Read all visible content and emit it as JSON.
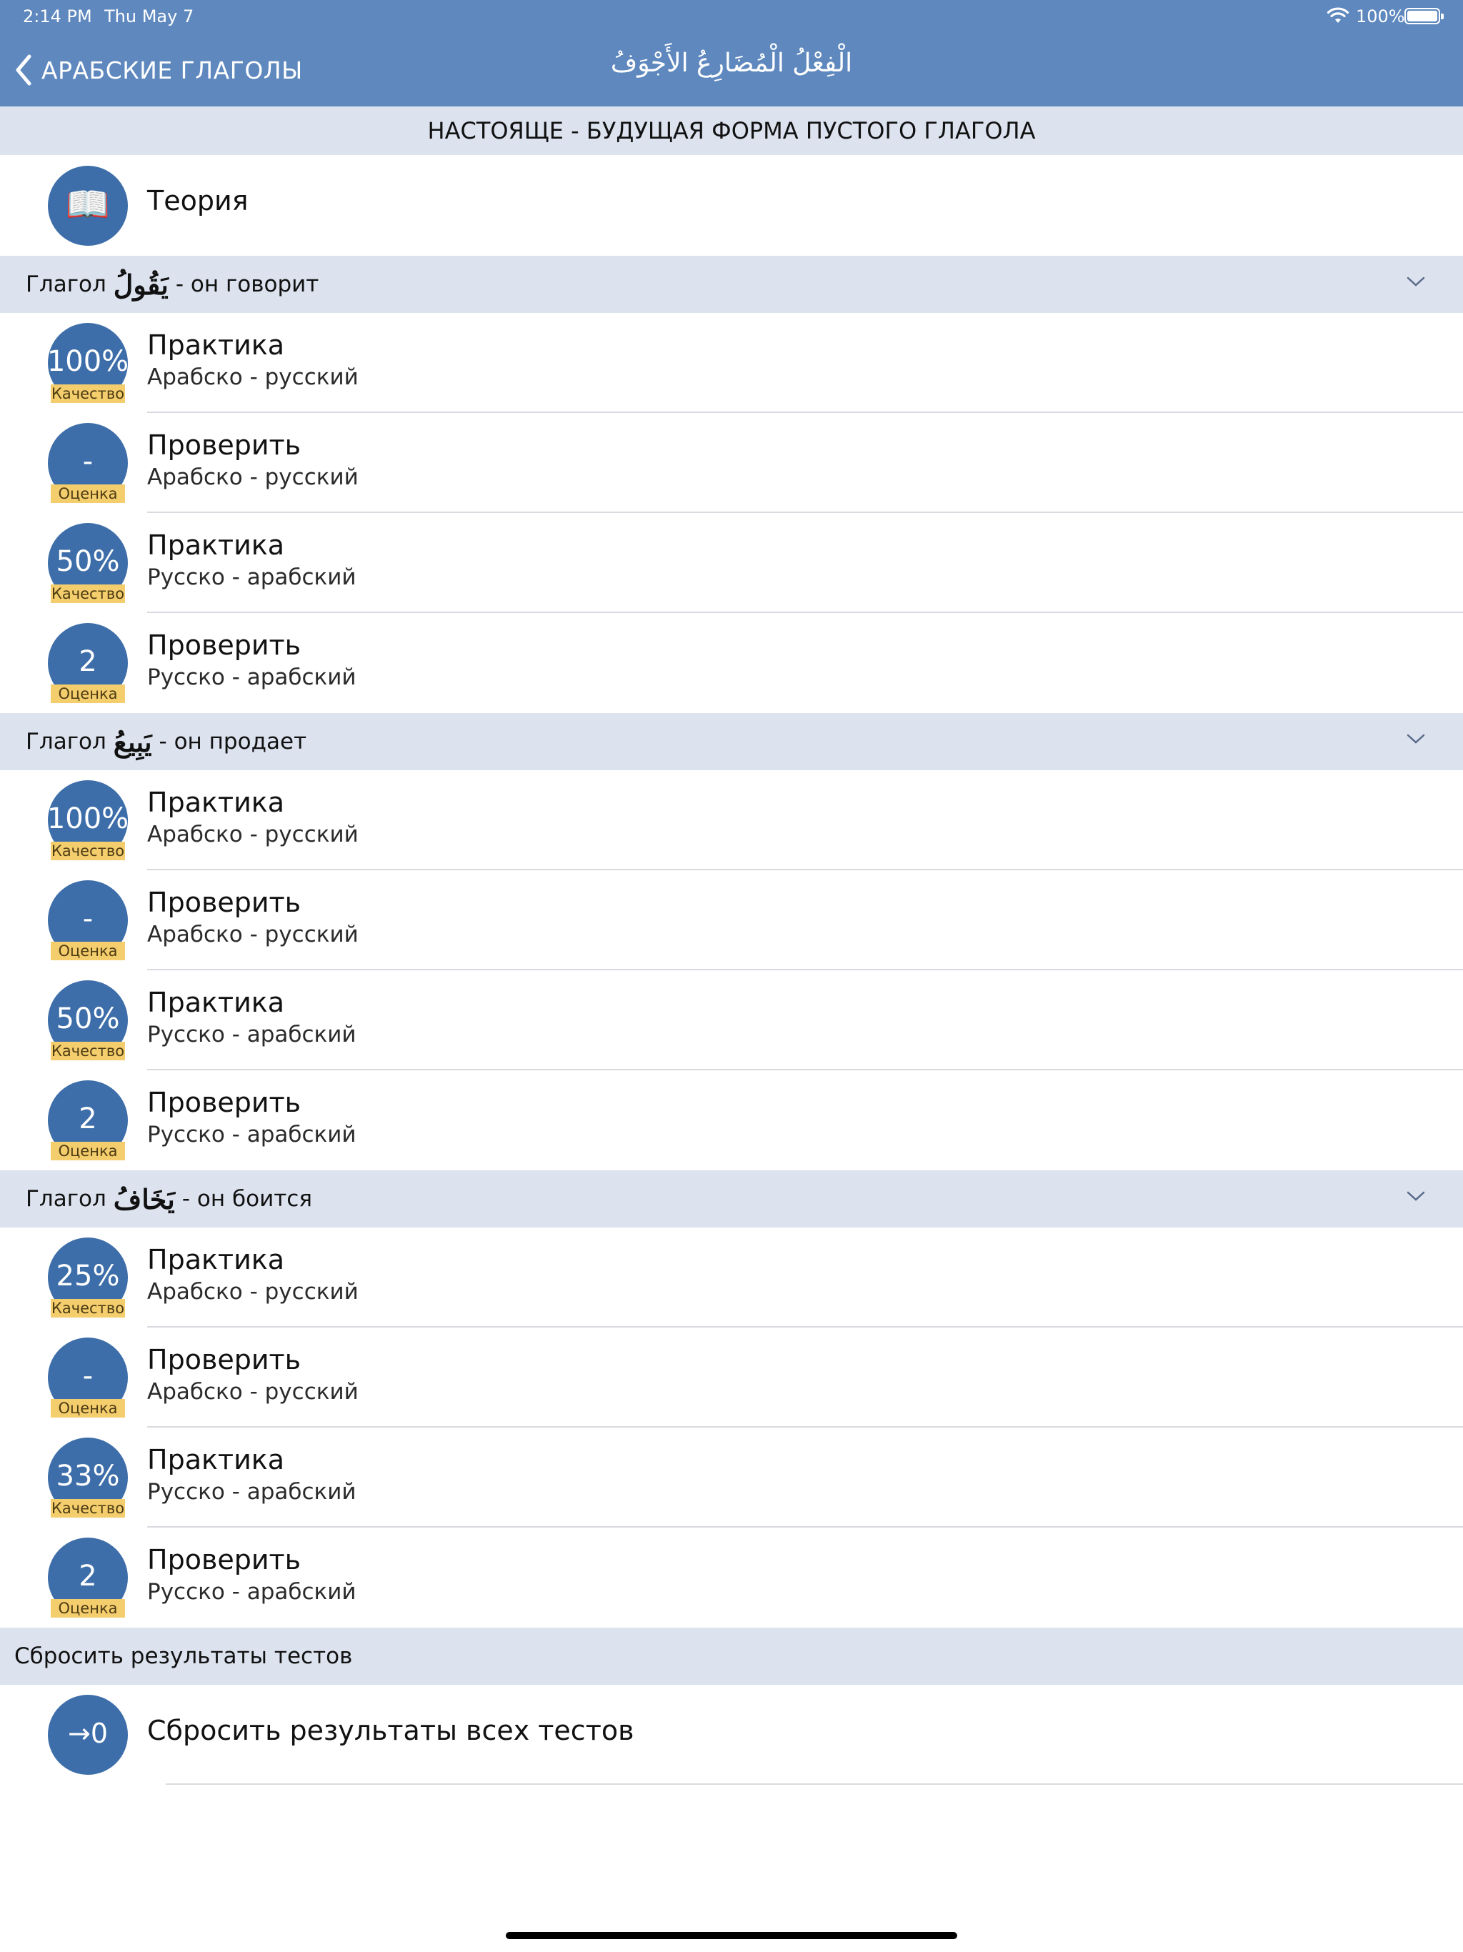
{
  "status_bar": {
    "time": "2:14 PM",
    "date": "Thu May 7",
    "battery": "100%"
  },
  "nav": {
    "back_label": "АРАБСКИЕ ГЛАГОЛЫ",
    "title": "الْفِعْلُ الْمُضَارِعُ الأَجْوَفُ"
  },
  "banner": "НАСТОЯЩЕ - БУДУЩАЯ ФОРМА ПУСТОГО ГЛАГОЛА",
  "theory": {
    "label": "Теория",
    "icon": "📖"
  },
  "verb_prefix": "Глагол",
  "sections": [
    {
      "arabic": "يَقُولُ",
      "meaning": "- он говорит",
      "items": [
        {
          "score": "100%",
          "badge": "Качество",
          "title": "Практика",
          "subtitle": "Арабско - русский"
        },
        {
          "score": "-",
          "badge": "Оценка",
          "title": "Проверить",
          "subtitle": "Арабско - русский"
        },
        {
          "score": "50%",
          "badge": "Качество",
          "title": "Практика",
          "subtitle": "Русско - арабский"
        },
        {
          "score": "2",
          "badge": "Оценка",
          "title": "Проверить",
          "subtitle": "Русско - арабский"
        }
      ]
    },
    {
      "arabic": "يَبِيعُ",
      "meaning": "- он продает",
      "items": [
        {
          "score": "100%",
          "badge": "Качество",
          "title": "Практика",
          "subtitle": "Арабско - русский"
        },
        {
          "score": "-",
          "badge": "Оценка",
          "title": "Проверить",
          "subtitle": "Арабско - русский"
        },
        {
          "score": "50%",
          "badge": "Качество",
          "title": "Практика",
          "subtitle": "Русско - арабский"
        },
        {
          "score": "2",
          "badge": "Оценка",
          "title": "Проверить",
          "subtitle": "Русско - арабский"
        }
      ]
    },
    {
      "arabic": "يَخَافُ",
      "meaning": "- он боится",
      "items": [
        {
          "score": "25%",
          "badge": "Качество",
          "title": "Практика",
          "subtitle": "Арабско - русский"
        },
        {
          "score": "-",
          "badge": "Оценка",
          "title": "Проверить",
          "subtitle": "Арабско - русский"
        },
        {
          "score": "33%",
          "badge": "Качество",
          "title": "Практика",
          "subtitle": "Русско - арабский"
        },
        {
          "score": "2",
          "badge": "Оценка",
          "title": "Проверить",
          "subtitle": "Русско - арабский"
        }
      ]
    }
  ],
  "reset_section": {
    "header": "Сбросить результаты тестов",
    "icon_label": "→0",
    "label": "Сбросить результаты всех тестов"
  },
  "colors": {
    "nav_bg": "#5e88be",
    "section_bg": "#dce3ef",
    "circle": "#3d6ea9",
    "badge": "#f4cd6d"
  }
}
